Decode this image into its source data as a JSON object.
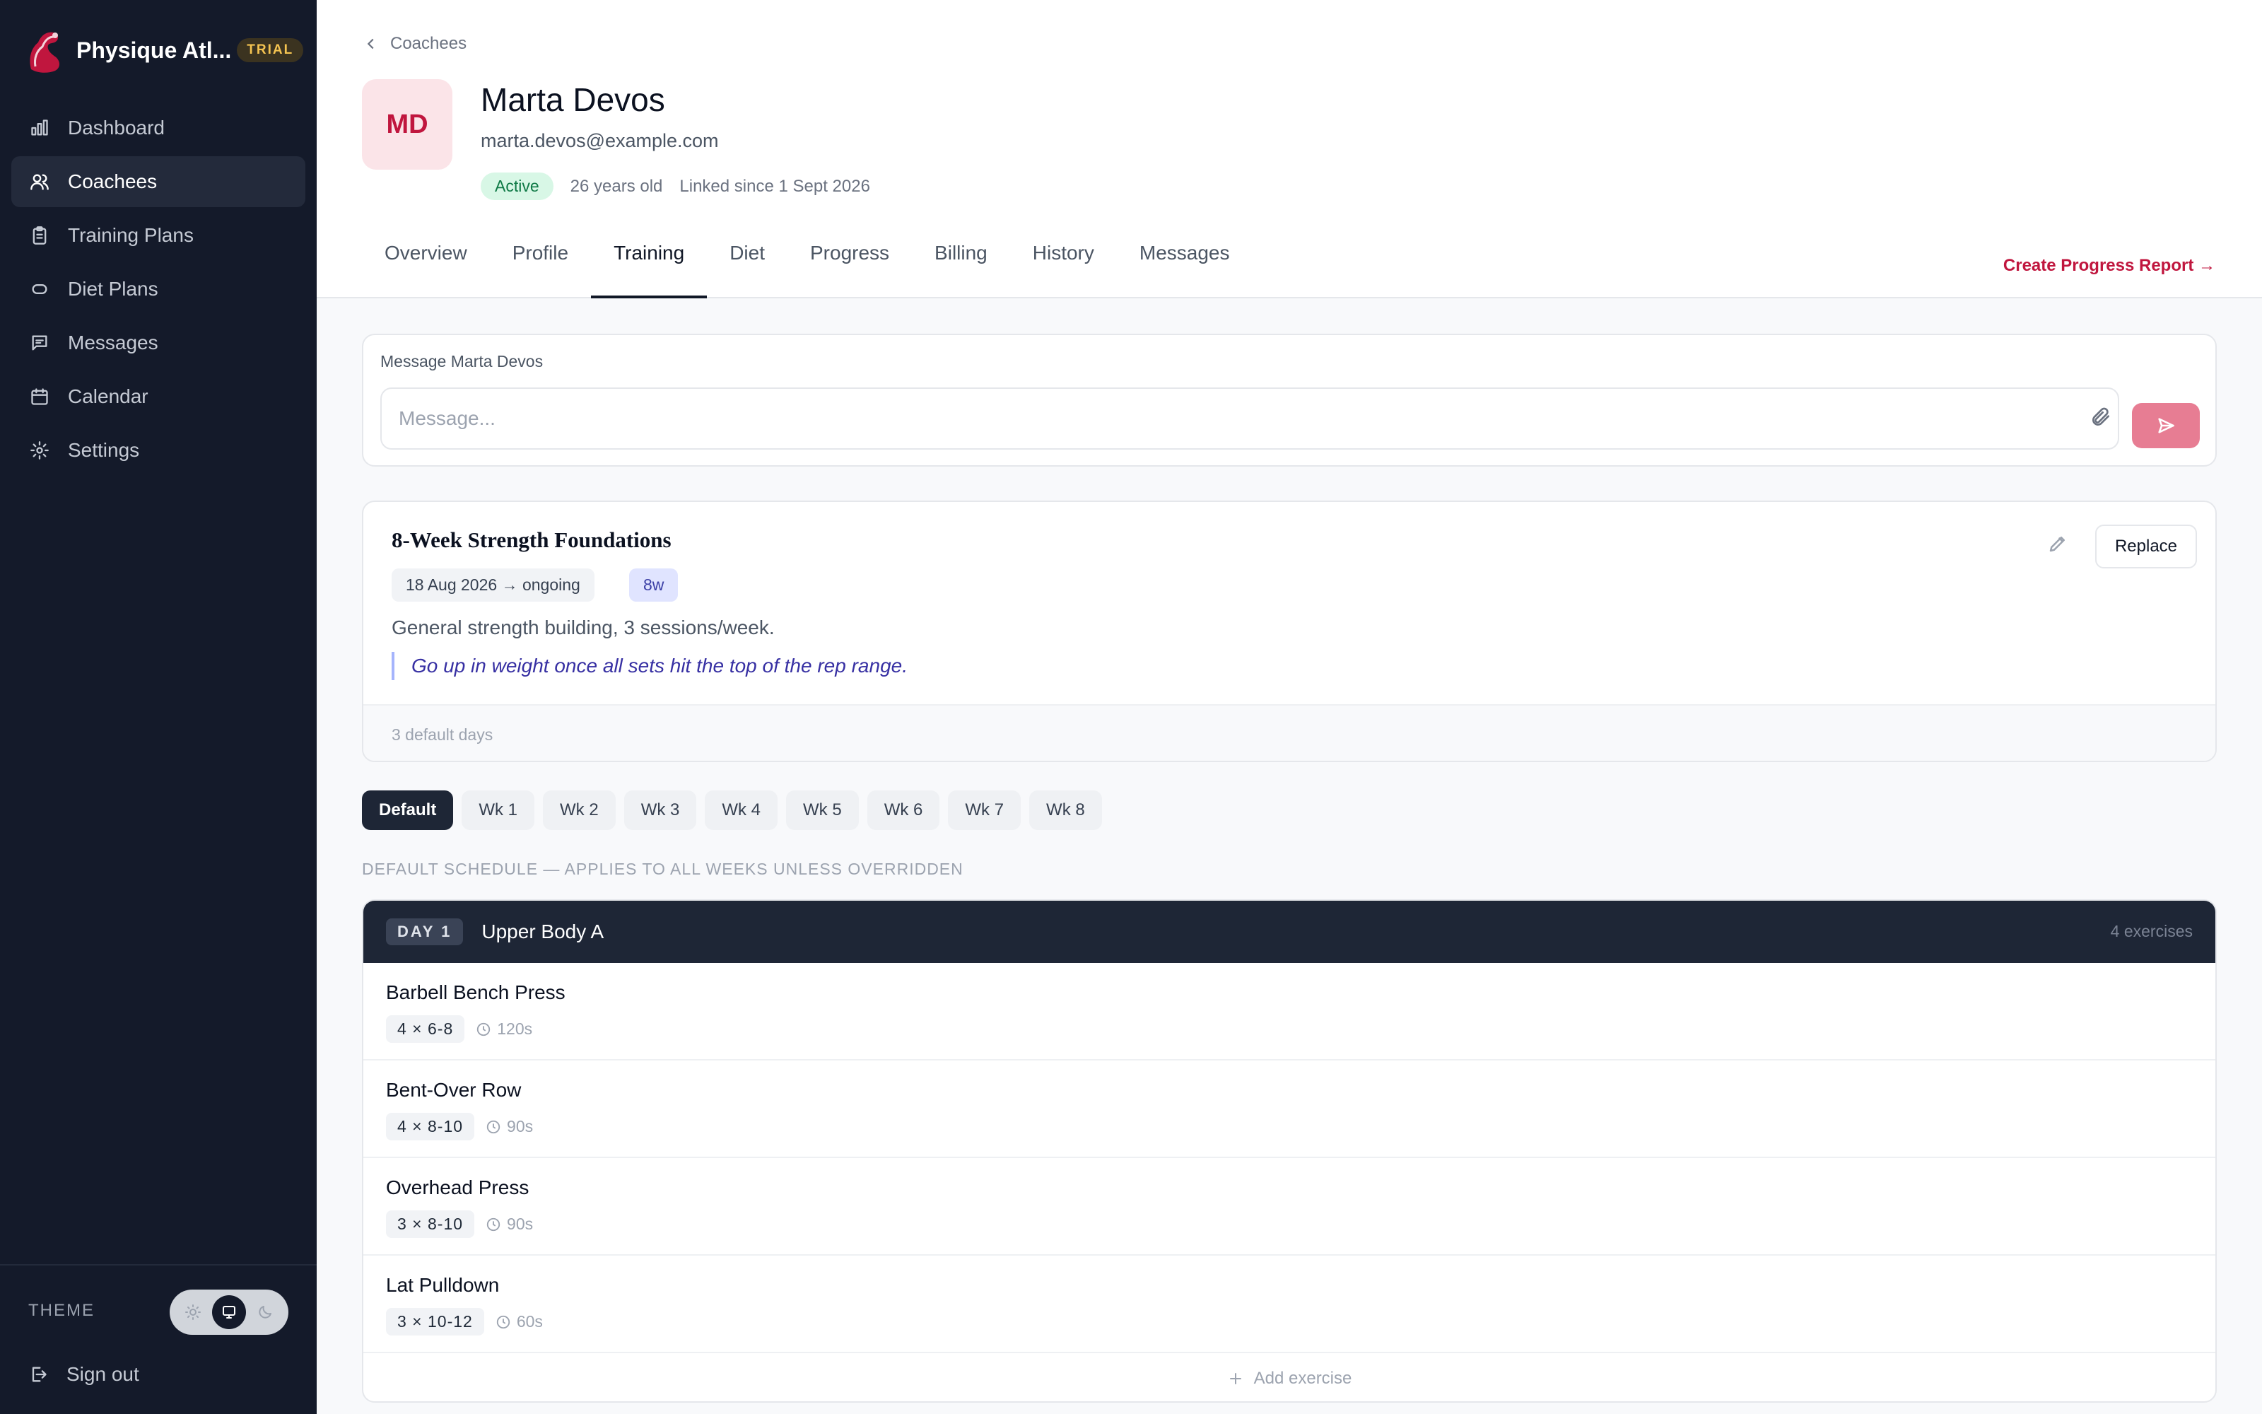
{
  "app": {
    "name": "Physique Atl...",
    "badge": "TRIAL"
  },
  "sidebar": {
    "items": [
      {
        "label": "Dashboard",
        "icon": "bar-chart-icon"
      },
      {
        "label": "Coachees",
        "icon": "users-icon",
        "active": true
      },
      {
        "label": "Training Plans",
        "icon": "clipboard-icon"
      },
      {
        "label": "Diet Plans",
        "icon": "pill-icon"
      },
      {
        "label": "Messages",
        "icon": "chat-icon"
      },
      {
        "label": "Calendar",
        "icon": "calendar-icon"
      },
      {
        "label": "Settings",
        "icon": "gear-icon"
      }
    ],
    "theme_label": "THEME",
    "sign_out": "Sign out"
  },
  "header": {
    "back_label": "Coachees",
    "avatar_initials": "MD",
    "name": "Marta Devos",
    "email": "marta.devos@example.com",
    "status": "Active",
    "age": "26 years old",
    "linked": "Linked since 1 Sept 2026",
    "tabs": [
      "Overview",
      "Profile",
      "Training",
      "Diet",
      "Progress",
      "Billing",
      "History",
      "Messages"
    ],
    "active_tab": "Training",
    "report_link": "Create Progress Report →"
  },
  "message": {
    "label": "Message Marta Devos",
    "placeholder": "Message..."
  },
  "plan": {
    "title": "8-Week Strength Foundations",
    "dates": "18 Aug 2026 → ongoing",
    "weeks": "8w",
    "description": "General strength building, 3 sessions/week.",
    "note": "Go up in weight once all sets hit the top of the rep range.",
    "footer": "3 default days",
    "replace_label": "Replace"
  },
  "week_chips": [
    "Default",
    "Wk 1",
    "Wk 2",
    "Wk 3",
    "Wk 4",
    "Wk 5",
    "Wk 6",
    "Wk 7",
    "Wk 8"
  ],
  "schedule_caption": "DEFAULT SCHEDULE — APPLIES TO ALL WEEKS UNLESS OVERRIDDEN",
  "day": {
    "badge": "DAY 1",
    "title": "Upper Body A",
    "count": "4 exercises",
    "exercises": [
      {
        "name": "Barbell Bench Press",
        "sets": "4 × 6-8",
        "rest": "120s"
      },
      {
        "name": "Bent-Over Row",
        "sets": "4 × 8-10",
        "rest": "90s"
      },
      {
        "name": "Overhead Press",
        "sets": "3 × 8-10",
        "rest": "90s"
      },
      {
        "name": "Lat Pulldown",
        "sets": "3 × 10-12",
        "rest": "60s"
      }
    ],
    "add_label": "Add exercise"
  },
  "colors": {
    "sidebar_bg": "#141a2a",
    "accent": "#c0163e",
    "send_button": "#e77d93",
    "active_status": "#0f7a46",
    "day_header": "#1e2636"
  }
}
